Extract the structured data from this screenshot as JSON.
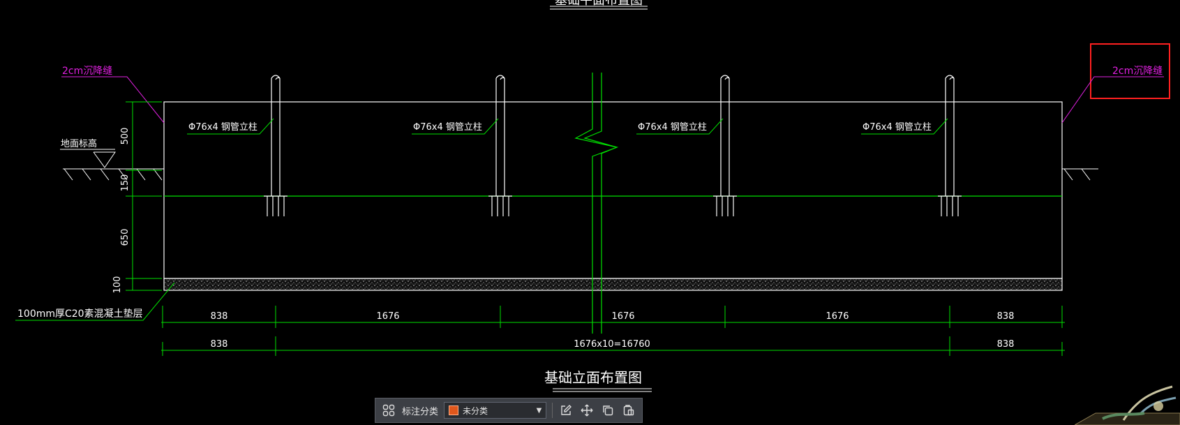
{
  "drawing": {
    "title_top_partial": "基础平面布置图",
    "title_bottom": "基础立面布置图",
    "settlement_joint_label": "2cm沉降缝",
    "ground_label": "地面标高",
    "cushion_label": "100mm厚C20素混凝土垫层",
    "post_label": "Φ76x4 钢管立柱",
    "vertical_dims": [
      "500",
      "150",
      "650",
      "100"
    ],
    "dim_row1": [
      "838",
      "1676",
      "1676",
      "1676",
      "838"
    ],
    "dim_row2": [
      "838",
      "1676x10=16760",
      "838"
    ]
  },
  "colors": {
    "outline": "#ffffff",
    "dimension": "#00e000",
    "annotation": "#e020e0",
    "highlight_box": "#ff2020"
  },
  "toolbar": {
    "grid_icon": "grid-icon",
    "category_label": "标注分类",
    "category_value": "未分类",
    "category_color": "#e0571c",
    "edit_icon": "edit-icon",
    "move_icon": "move-icon",
    "copy_icon": "copy-icon",
    "paste_icon": "paste-icon"
  }
}
